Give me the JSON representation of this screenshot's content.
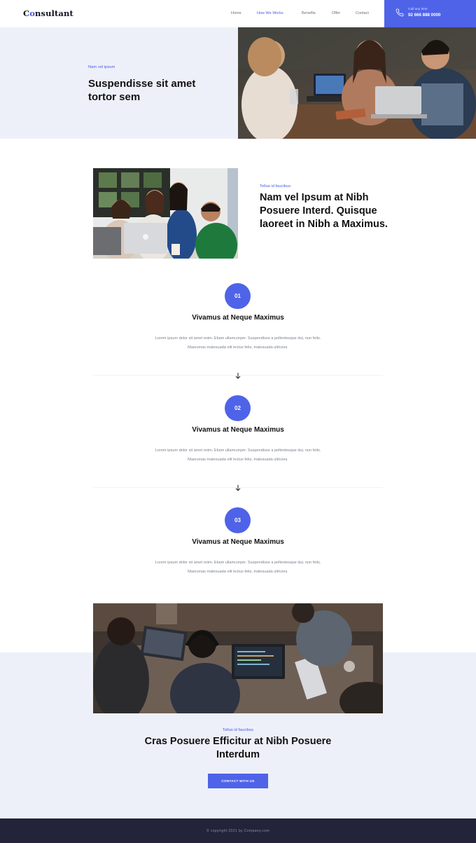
{
  "header": {
    "logo": {
      "before": "C",
      "dot": "o",
      "after": "nsultant"
    },
    "nav": [
      "Home",
      "How We Works",
      "Benefits",
      "Offer",
      "Contact"
    ],
    "active_nav": "How We Works",
    "call_label": "Call any time",
    "call_number": "92 666 888 0000"
  },
  "hero": {
    "kicker": "Nam vel ipsum",
    "title": "Suspendisse sit amet tortor sem"
  },
  "intro": {
    "kicker": "Tellus id faucibus",
    "title": "Nam vel Ipsum at Nibh Posuere Interd. Quisque laoreet in Nibh a Maximus."
  },
  "steps": [
    {
      "number": "01",
      "title": "Vivamus at Neque Maximus",
      "text": "Lorem ipsum dolor sit amet enim. Etiam ullamcorper. Suspendisse a pellentesque dui, non felis. Maecenas malesuada elit lectus felis, malesuada ultricies."
    },
    {
      "number": "02",
      "title": "Vivamus at Neque Maximus",
      "text": "Lorem ipsum dolor sit amet enim. Etiam ullamcorper. Suspendisse a pellentesque dui, non felis. Maecenas malesuada elit lectus felis, malesuada ultricies."
    },
    {
      "number": "03",
      "title": "Vivamus at Neque Maximus",
      "text": "Lorem ipsum dolor sit amet enim. Etiam ullamcorper. Suspendisse a pellentesque dui, non felis. Maecenas malesuada elit lectus felis, malesuada ultricies."
    }
  ],
  "cta_section": {
    "kicker": "Tellus id faucibus",
    "title": "Cras Posuere Efficitur at Nibh Posuere Interdum",
    "button": "CONTACT WITH US"
  },
  "footer": {
    "copyright": "© copyright 2021 by Company.com"
  },
  "icons": {
    "phone": "phone-icon",
    "arrow": "arrow-down-icon"
  },
  "colors": {
    "accent": "#4f63e8",
    "light_bg": "#eef0f9",
    "footer_bg": "#23233a"
  }
}
